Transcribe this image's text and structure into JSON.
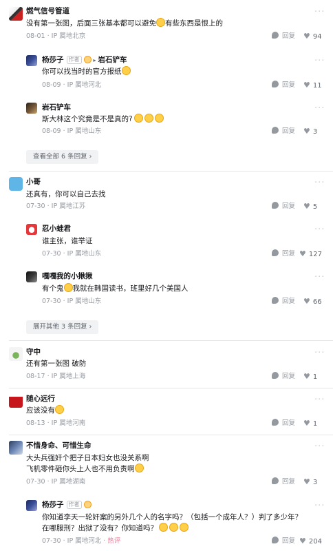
{
  "threads": [
    {
      "user": "燃气信号管道",
      "text": "没有第一张图，后面三张基本都可以避免",
      "text_after_emoji": "有些东西是恨上的",
      "date": "08-01",
      "ip": "IP 属地北京",
      "reply": "回复",
      "likes": "94",
      "replies": [
        {
          "user": "杨莎子",
          "author_tag": "作者",
          "reply_to": "岩石铲车",
          "text": "你可以找当时的官方报纸",
          "date": "08-09",
          "ip": "IP 属地河北",
          "reply": "回复",
          "likes": "11"
        },
        {
          "user": "岩石铲车",
          "text": "斯大林这个究竟是不是真的?",
          "date": "08-09",
          "ip": "IP 属地山东",
          "reply": "回复",
          "likes": "3"
        }
      ],
      "expand": "查看全部 6 条回复"
    },
    {
      "user": "小哥",
      "text": "还真有，你可以自己去找",
      "date": "07-30",
      "ip": "IP 属地江苏",
      "reply": "回复",
      "likes": "5",
      "replies": [
        {
          "user": "忍小蛙君",
          "text": "谁主张，谁举证",
          "date": "07-30",
          "ip": "IP 属地山东",
          "reply": "回复",
          "likes": "127"
        },
        {
          "user": "嘎嘎我的小揪揪",
          "text_before": "有个鬼",
          "text": "我就在韩国读书，班里好几个美国人",
          "date": "07-30",
          "ip": "IP 属地山东",
          "reply": "回复",
          "likes": "66"
        }
      ],
      "expand": "展开其他 3 条回复"
    },
    {
      "user": "守中",
      "text": "还有第一张图 破防",
      "date": "08-17",
      "ip": "IP 属地上海",
      "reply": "回复",
      "likes": "1"
    },
    {
      "user": "随心远行",
      "text": "应该没有",
      "date": "08-13",
      "ip": "IP 属地河南",
      "reply": "回复",
      "likes": "1"
    },
    {
      "user": "不惜身命、可惜生命",
      "text": "大头兵强奸个把子日本妇女也没关系啊",
      "text2": "飞机零件砸你头上人也不用负责啊",
      "date": "07-30",
      "ip": "IP 属地湖南",
      "reply": "回复",
      "likes": "3",
      "replies": [
        {
          "user": "杨莎子",
          "author_tag": "作者",
          "text": "你知道李天一轮奸案的另外几个人的名字吗？（包括一个成年人？）判了多少年？",
          "text2": "在哪服刑？出狱了没有？你知道吗？",
          "date": "07-30",
          "ip": "IP 属地河北",
          "hot": "热评",
          "reply": "回复",
          "likes": "204"
        }
      ]
    }
  ],
  "icons": {
    "more": "more-dots-icon",
    "reply": "reply-bubble-icon",
    "like": "heart-icon",
    "expand_arrow": "chevron-right-icon"
  },
  "colors": {
    "text": "#18191c",
    "meta": "#9499a0",
    "hot": "#fb7299",
    "expand_bg": "#f1f2f3"
  },
  "glyphs": {
    "more": "···",
    "heart": "♥",
    "chevron": "›",
    "arrow": "▸"
  }
}
